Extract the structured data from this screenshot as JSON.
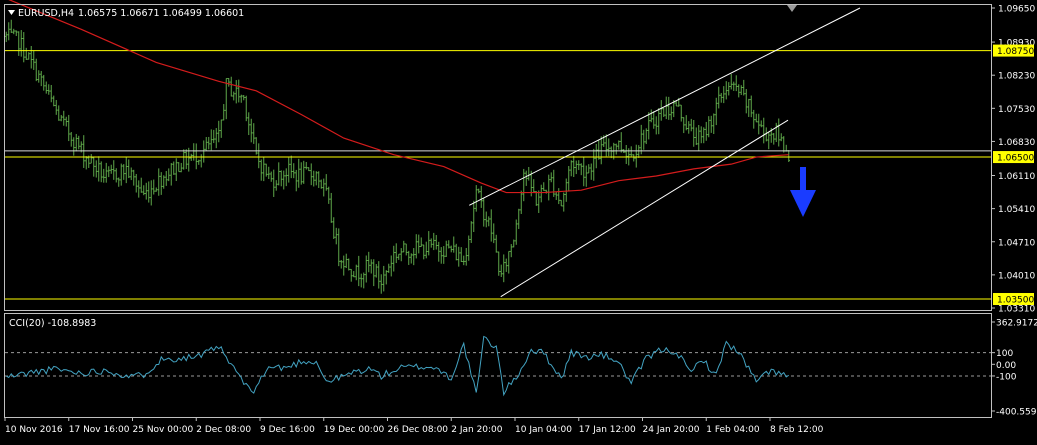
{
  "header": {
    "symbol": "EURUSD,H4",
    "ohlc": "1.06575 1.06671 1.06499 1.06601"
  },
  "colors": {
    "background": "#000000",
    "frame": "#c0c0c0",
    "bars": "#5fa84a",
    "moving_average": "#d41c1c",
    "channel": "#ffffff",
    "support_resistance": "#ffff00",
    "arrow": "#1a3cff",
    "cci": "#43a3c2",
    "text": "#ffffff",
    "label_bg": "#ffff00",
    "label_text": "#000000"
  },
  "chart_data": [
    {
      "type": "candlestick",
      "title": "EURUSD,H4",
      "y_ticks": [
        "1.09650",
        "1.08930",
        "1.08230",
        "1.07530",
        "1.06830",
        "1.06110",
        "1.05410",
        "1.04710",
        "1.04010",
        "1.03310"
      ],
      "y_range": [
        1.0331,
        1.0965
      ],
      "x_ticks": [
        "10 Nov 2016",
        "17 Nov 16:00",
        "25 Nov 00:00",
        "2 Dec 08:00",
        "9 Dec 16:00",
        "19 Dec 00:00",
        "26 Dec 08:00",
        "2 Jan 20:00",
        "10 Jan 04:00",
        "17 Jan 12:00",
        "24 Jan 20:00",
        "1 Feb 04:00",
        "8 Feb 12:00"
      ],
      "bar_count": 300,
      "close_waypoints": [
        [
          0,
          1.0905
        ],
        [
          5,
          1.0895
        ],
        [
          12,
          1.083
        ],
        [
          22,
          1.0725
        ],
        [
          32,
          1.065
        ],
        [
          40,
          1.0605
        ],
        [
          48,
          1.0625
        ],
        [
          55,
          1.057
        ],
        [
          62,
          1.0605
        ],
        [
          70,
          1.064
        ],
        [
          78,
          1.066
        ],
        [
          85,
          1.069
        ],
        [
          88,
          1.08
        ],
        [
          95,
          1.0775
        ],
        [
          100,
          1.065
        ],
        [
          106,
          1.06
        ],
        [
          112,
          1.062
        ],
        [
          118,
          1.061
        ],
        [
          124,
          1.0615
        ],
        [
          128,
          1.057
        ],
        [
          133,
          1.0445
        ],
        [
          140,
          1.0405
        ],
        [
          146,
          1.042
        ],
        [
          150,
          1.0385
        ],
        [
          155,
          1.0445
        ],
        [
          162,
          1.0455
        ],
        [
          170,
          1.046
        ],
        [
          178,
          1.0455
        ],
        [
          183,
          1.043
        ],
        [
          188,
          1.0575
        ],
        [
          194,
          1.0495
        ],
        [
          198,
          1.0395
        ],
        [
          203,
          1.048
        ],
        [
          207,
          1.062
        ],
        [
          212,
          1.056
        ],
        [
          218,
          1.06
        ],
        [
          222,
          1.055
        ],
        [
          226,
          1.064
        ],
        [
          232,
          1.062
        ],
        [
          238,
          1.0665
        ],
        [
          244,
          1.068
        ],
        [
          250,
          1.0655
        ],
        [
          256,
          1.0705
        ],
        [
          262,
          1.0745
        ],
        [
          268,
          1.076
        ],
        [
          274,
          1.07
        ],
        [
          278,
          1.0685
        ],
        [
          284,
          1.0755
        ],
        [
          288,
          1.08
        ],
        [
          293,
          1.079
        ],
        [
          298,
          1.0745
        ],
        [
          303,
          1.07
        ],
        [
          308,
          1.07
        ],
        [
          313,
          1.066
        ]
      ],
      "moving_average": [
        [
          0,
          1.0985
        ],
        [
          30,
          1.092
        ],
        [
          60,
          1.085
        ],
        [
          85,
          1.081
        ],
        [
          100,
          1.079
        ],
        [
          118,
          1.074
        ],
        [
          135,
          1.069
        ],
        [
          155,
          1.0655
        ],
        [
          175,
          1.063
        ],
        [
          190,
          1.0595
        ],
        [
          200,
          1.0575
        ],
        [
          215,
          1.0575
        ],
        [
          230,
          1.058
        ],
        [
          245,
          1.06
        ],
        [
          260,
          1.061
        ],
        [
          275,
          1.0625
        ],
        [
          290,
          1.0635
        ],
        [
          300,
          1.065
        ],
        [
          313,
          1.0655
        ]
      ],
      "channel": {
        "lower": [
          [
            197.8,
            1.0355
          ],
          [
            312.7,
            1.0728
          ]
        ],
        "upper": [
          [
            185.2,
            1.0548
          ],
          [
            341.5,
            1.0965
          ]
        ]
      },
      "levels": [
        {
          "value": 1.0875,
          "label": "1.08750"
        },
        {
          "value": 1.065,
          "label": "1.06500"
        },
        {
          "value": 1.035,
          "label": "1.03500"
        }
      ],
      "lines": [
        1.0663
      ],
      "annotation": "down-arrow"
    },
    {
      "type": "line",
      "title": "CCI(20) -108.8983",
      "y_range": [
        -400.5593,
        362.9172
      ],
      "y_ticks": [
        "362.9172",
        "100",
        "0.00",
        "-100",
        "-400.5593"
      ],
      "reference_levels": [
        100,
        -100
      ],
      "waypoints": [
        [
          0,
          -110
        ],
        [
          10,
          -70
        ],
        [
          20,
          -40
        ],
        [
          30,
          -75
        ],
        [
          40,
          -50
        ],
        [
          50,
          -110
        ],
        [
          55,
          -85
        ],
        [
          62,
          40
        ],
        [
          70,
          55
        ],
        [
          78,
          70
        ],
        [
          85,
          155
        ],
        [
          88,
          50
        ],
        [
          92,
          -60
        ],
        [
          98,
          -250
        ],
        [
          105,
          -25
        ],
        [
          112,
          -30
        ],
        [
          118,
          25
        ],
        [
          124,
          25
        ],
        [
          128,
          -150
        ],
        [
          134,
          -110
        ],
        [
          140,
          -60
        ],
        [
          146,
          -40
        ],
        [
          150,
          -100
        ],
        [
          158,
          -30
        ],
        [
          165,
          -20
        ],
        [
          172,
          -30
        ],
        [
          178,
          -120
        ],
        [
          183,
          170
        ],
        [
          188,
          -260
        ],
        [
          191,
          220
        ],
        [
          196,
          150
        ],
        [
          199,
          -240
        ],
        [
          205,
          -80
        ],
        [
          210,
          125
        ],
        [
          215,
          95
        ],
        [
          222,
          -120
        ],
        [
          226,
          100
        ],
        [
          232,
          60
        ],
        [
          238,
          80
        ],
        [
          244,
          40
        ],
        [
          250,
          -160
        ],
        [
          256,
          50
        ],
        [
          262,
          125
        ],
        [
          268,
          110
        ],
        [
          274,
          -80
        ],
        [
          278,
          55
        ],
        [
          284,
          -100
        ],
        [
          288,
          195
        ],
        [
          294,
          70
        ],
        [
          300,
          -150
        ],
        [
          306,
          -45
        ],
        [
          313,
          -115
        ]
      ]
    }
  ]
}
